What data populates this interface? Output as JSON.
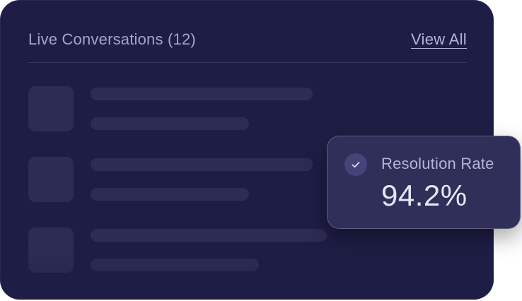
{
  "conversations": {
    "title": "Live Conversations (12)",
    "view_all_label": "View All",
    "placeholder_rows": 3
  },
  "metric": {
    "label": "Resolution Rate",
    "value": "94.2%",
    "icon": "check-icon"
  },
  "colors": {
    "card_background": "#1e1d45",
    "metric_background": "#302f5a",
    "muted_text": "#a4a6c6",
    "value_text": "#e6e6f2"
  }
}
